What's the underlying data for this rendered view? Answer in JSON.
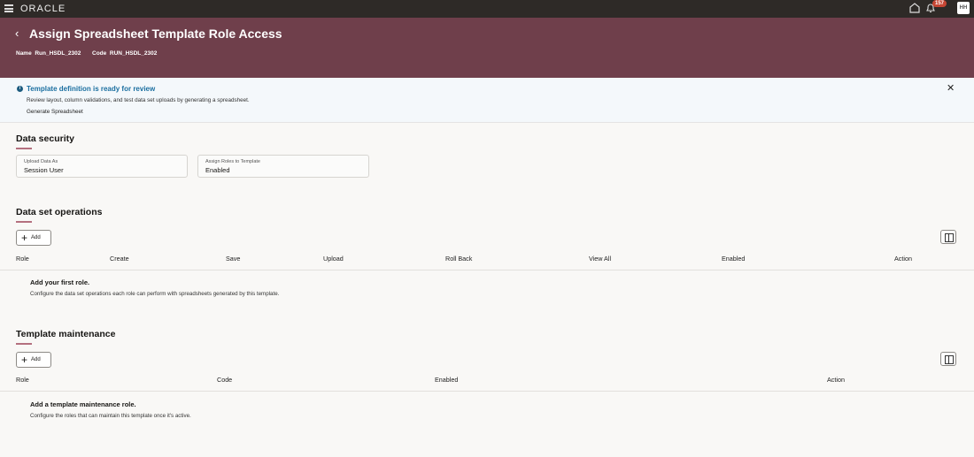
{
  "topbar": {
    "brand": "ORACLE",
    "notification_count": "157",
    "avatar": "HH"
  },
  "header": {
    "back": "‹",
    "title": "Assign Spreadsheet Template Role Access",
    "name_label": "Name",
    "name_value": "Run_HSDL_2302",
    "code_label": "Code",
    "code_value": "RUN_HSDL_2302"
  },
  "info": {
    "icon": "i",
    "title": "Template definition is ready for review",
    "description": "Review layout, column validations, and test data set uploads by generating a spreadsheet.",
    "link": "Generate Spreadsheet",
    "close": "✕"
  },
  "data_security": {
    "title": "Data security",
    "fields": [
      {
        "label": "Upload Data As",
        "value": "Session User"
      },
      {
        "label": "Assign Roles to Template",
        "value": "Enabled"
      }
    ]
  },
  "dataset_ops": {
    "title": "Data set operations",
    "add": "Add",
    "plus": "+",
    "columns": [
      "Role",
      "Create",
      "Save",
      "Upload",
      "Roll Back",
      "View All",
      "Enabled",
      "Action"
    ],
    "empty_title": "Add your first role.",
    "empty_desc": "Configure the data set operations each role can perform with spreadsheets generated by this template."
  },
  "maintenance": {
    "title": "Template maintenance",
    "add": "Add",
    "plus": "+",
    "columns": [
      "Role",
      "Code",
      "Enabled",
      "Action"
    ],
    "empty_title": "Add a template maintenance role.",
    "empty_desc": "Configure the roles that can maintain this template once it's active."
  }
}
